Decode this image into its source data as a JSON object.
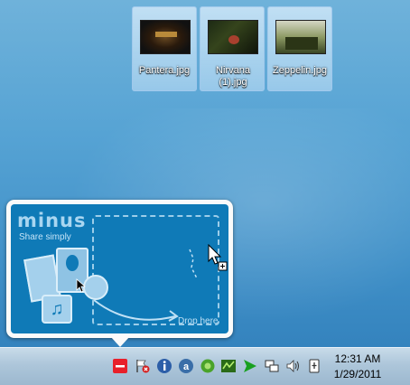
{
  "desktop": {
    "files": [
      {
        "name": "Pantera.jpg"
      },
      {
        "name": "Nirvana (1).jpg"
      },
      {
        "name": "Zeppelin.jpg"
      }
    ]
  },
  "minus_popup": {
    "brand": "minus",
    "tagline": "Share simply",
    "drop_label": "Drop here"
  },
  "taskbar": {
    "time": "12:31 AM",
    "date": "1/29/2011",
    "tray_icons": [
      "minus-icon",
      "action-center-flag-icon",
      "info-icon",
      "amazon-icon",
      "green-app-icon",
      "green-app-icon-2",
      "green-arrow-icon",
      "network-icon",
      "volume-icon",
      "power-icon"
    ]
  },
  "colors": {
    "popup_blue": "#0f7ab7",
    "minus_red": "#e8202a"
  }
}
